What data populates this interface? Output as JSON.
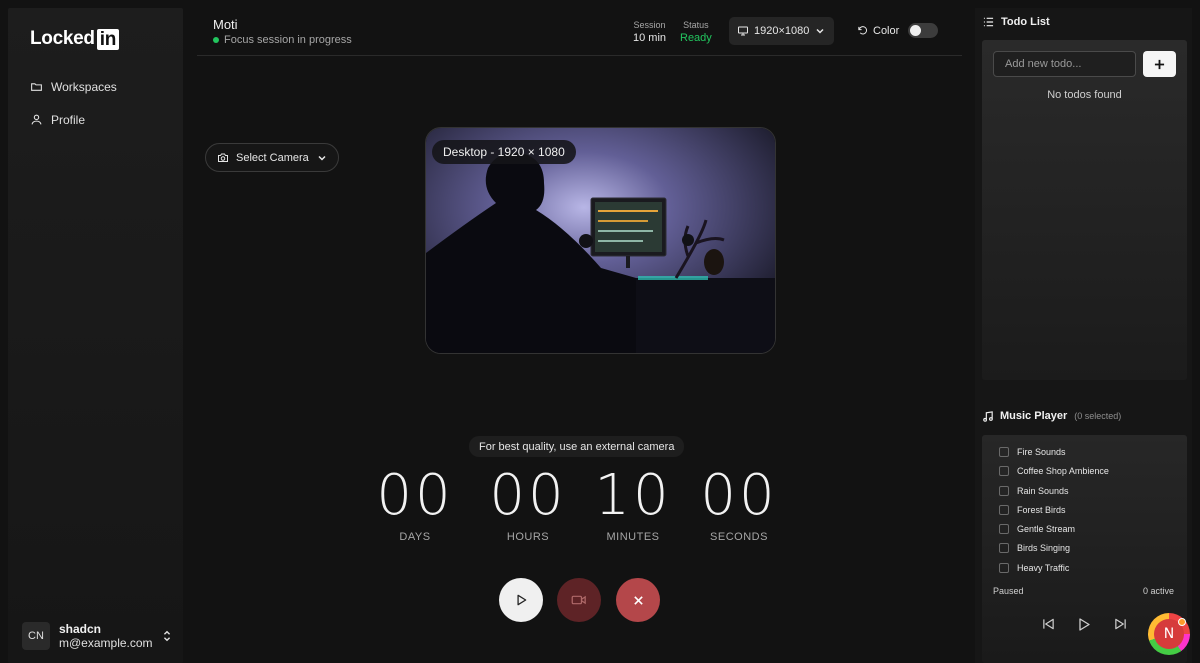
{
  "app": {
    "logo_text": "Locked",
    "logo_badge": "in"
  },
  "sidebar": {
    "items": [
      {
        "label": "Workspaces",
        "icon": "folder-icon"
      },
      {
        "label": "Profile",
        "icon": "user-icon"
      }
    ],
    "user": {
      "initials": "CN",
      "name": "shadcn",
      "email": "m@example.com"
    }
  },
  "header": {
    "title": "Moti",
    "subtitle": "Focus session in progress",
    "session_label": "Session",
    "session_value": "10 min",
    "status_label": "Status",
    "status_value": "Ready",
    "resolution": "1920×1080",
    "color_label": "Color",
    "color_enabled": false
  },
  "camera": {
    "select_label": "Select Camera",
    "preview_badge": "Desktop - 1920 × 1080",
    "tip": "For best quality, use an external camera"
  },
  "timer": {
    "days": "00",
    "hours": "00",
    "minutes": "10",
    "seconds": "00",
    "days_label": "DAYS",
    "hours_label": "HOURS",
    "minutes_label": "MINUTES",
    "seconds_label": "SECONDS"
  },
  "todo": {
    "title": "Todo List",
    "placeholder": "Add new todo...",
    "add_label": "+",
    "empty": "No todos found"
  },
  "music": {
    "title": "Music Player",
    "selected": "(0 selected)",
    "tracks": [
      "Fire Sounds",
      "Coffee Shop Ambience",
      "Rain Sounds",
      "Forest Birds",
      "Gentle Stream",
      "Birds Singing",
      "Heavy Traffic"
    ],
    "state": "Paused",
    "active": "0 active"
  },
  "notification_avatar": {
    "initial": "N"
  },
  "colors": {
    "status_ready": "#22c55e",
    "stop_button": "#b4474a",
    "video_button": "#5e2326"
  }
}
